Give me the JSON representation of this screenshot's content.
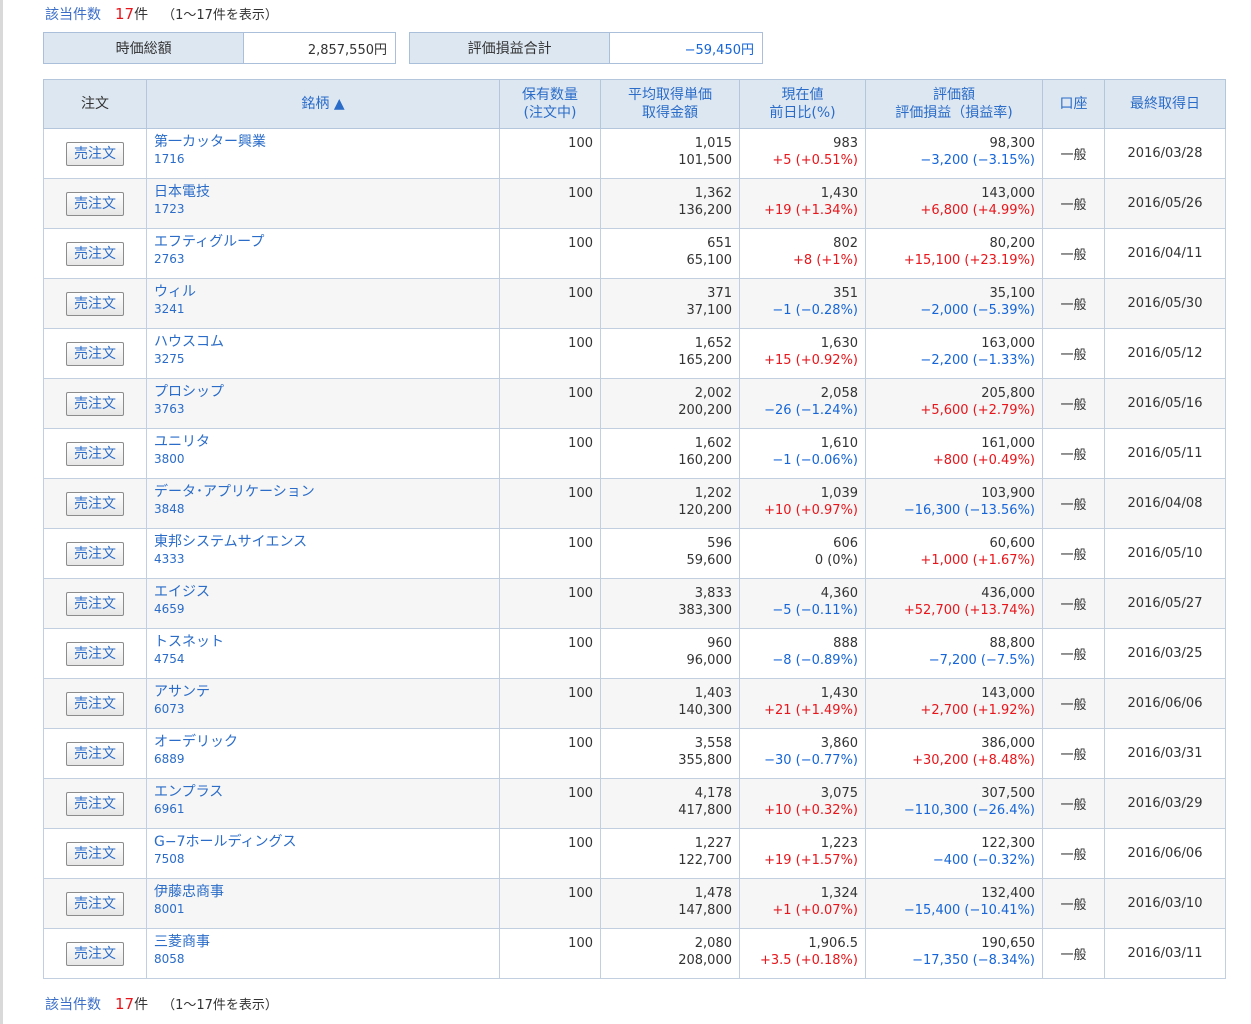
{
  "summary": {
    "count_label": "該当件数",
    "count": "17",
    "count_unit": "件",
    "range_text": "（1〜17件を表示）",
    "market_value_label": "時価総額",
    "market_value": "2,857,550円",
    "pl_total_label": "評価損益合計",
    "pl_total": "−59,450円"
  },
  "table": {
    "headers": {
      "order": "注文",
      "name": "銘柄 ▲",
      "qty_1": "保有数量",
      "qty_2": "(注文中)",
      "avg_1": "平均取得単価",
      "avg_2": "取得金額",
      "price_1": "現在値",
      "price_2": "前日比(%)",
      "eval_1": "評価額",
      "eval_2": "評価損益（損益率)",
      "account": "口座",
      "date": "最終取得日"
    },
    "sell_label": "売注文",
    "rows": [
      {
        "name": "第一カッター興業",
        "code": "1716",
        "qty": "100",
        "avg": "1,015",
        "cost": "101,500",
        "price": "983",
        "chg": "+5 (+0.51%)",
        "chg_sign": "pos",
        "value": "98,300",
        "pl": "−3,200 (−3.15%)",
        "pl_sign": "neg",
        "account": "一般",
        "date": "2016/03/28"
      },
      {
        "name": "日本電技",
        "code": "1723",
        "qty": "100",
        "avg": "1,362",
        "cost": "136,200",
        "price": "1,430",
        "chg": "+19 (+1.34%)",
        "chg_sign": "pos",
        "value": "143,000",
        "pl": "+6,800 (+4.99%)",
        "pl_sign": "pos",
        "account": "一般",
        "date": "2016/05/26"
      },
      {
        "name": "エフティグループ",
        "code": "2763",
        "qty": "100",
        "avg": "651",
        "cost": "65,100",
        "price": "802",
        "chg": "+8 (+1%)",
        "chg_sign": "pos",
        "value": "80,200",
        "pl": "+15,100 (+23.19%)",
        "pl_sign": "pos",
        "account": "一般",
        "date": "2016/04/11"
      },
      {
        "name": "ウィル",
        "code": "3241",
        "qty": "100",
        "avg": "371",
        "cost": "37,100",
        "price": "351",
        "chg": "−1 (−0.28%)",
        "chg_sign": "neg",
        "value": "35,100",
        "pl": "−2,000 (−5.39%)",
        "pl_sign": "neg",
        "account": "一般",
        "date": "2016/05/30"
      },
      {
        "name": "ハウスコム",
        "code": "3275",
        "qty": "100",
        "avg": "1,652",
        "cost": "165,200",
        "price": "1,630",
        "chg": "+15 (+0.92%)",
        "chg_sign": "pos",
        "value": "163,000",
        "pl": "−2,200 (−1.33%)",
        "pl_sign": "neg",
        "account": "一般",
        "date": "2016/05/12"
      },
      {
        "name": "プロシップ",
        "code": "3763",
        "qty": "100",
        "avg": "2,002",
        "cost": "200,200",
        "price": "2,058",
        "chg": "−26 (−1.24%)",
        "chg_sign": "neg",
        "value": "205,800",
        "pl": "+5,600 (+2.79%)",
        "pl_sign": "pos",
        "account": "一般",
        "date": "2016/05/16"
      },
      {
        "name": "ユニリタ",
        "code": "3800",
        "qty": "100",
        "avg": "1,602",
        "cost": "160,200",
        "price": "1,610",
        "chg": "−1 (−0.06%)",
        "chg_sign": "neg",
        "value": "161,000",
        "pl": "+800 (+0.49%)",
        "pl_sign": "pos",
        "account": "一般",
        "date": "2016/05/11"
      },
      {
        "name": "データ･アプリケーション",
        "code": "3848",
        "qty": "100",
        "avg": "1,202",
        "cost": "120,200",
        "price": "1,039",
        "chg": "+10 (+0.97%)",
        "chg_sign": "pos",
        "value": "103,900",
        "pl": "−16,300 (−13.56%)",
        "pl_sign": "neg",
        "account": "一般",
        "date": "2016/04/08"
      },
      {
        "name": "東邦システムサイエンス",
        "code": "4333",
        "qty": "100",
        "avg": "596",
        "cost": "59,600",
        "price": "606",
        "chg": "0 (0%)",
        "chg_sign": "zero",
        "value": "60,600",
        "pl": "+1,000 (+1.67%)",
        "pl_sign": "pos",
        "account": "一般",
        "date": "2016/05/10"
      },
      {
        "name": "エイジス",
        "code": "4659",
        "qty": "100",
        "avg": "3,833",
        "cost": "383,300",
        "price": "4,360",
        "chg": "−5 (−0.11%)",
        "chg_sign": "neg",
        "value": "436,000",
        "pl": "+52,700 (+13.74%)",
        "pl_sign": "pos",
        "account": "一般",
        "date": "2016/05/27"
      },
      {
        "name": "トスネット",
        "code": "4754",
        "qty": "100",
        "avg": "960",
        "cost": "96,000",
        "price": "888",
        "chg": "−8 (−0.89%)",
        "chg_sign": "neg",
        "value": "88,800",
        "pl": "−7,200 (−7.5%)",
        "pl_sign": "neg",
        "account": "一般",
        "date": "2016/03/25"
      },
      {
        "name": "アサンテ",
        "code": "6073",
        "qty": "100",
        "avg": "1,403",
        "cost": "140,300",
        "price": "1,430",
        "chg": "+21 (+1.49%)",
        "chg_sign": "pos",
        "value": "143,000",
        "pl": "+2,700 (+1.92%)",
        "pl_sign": "pos",
        "account": "一般",
        "date": "2016/06/06"
      },
      {
        "name": "オーデリック",
        "code": "6889",
        "qty": "100",
        "avg": "3,558",
        "cost": "355,800",
        "price": "3,860",
        "chg": "−30 (−0.77%)",
        "chg_sign": "neg",
        "value": "386,000",
        "pl": "+30,200 (+8.48%)",
        "pl_sign": "pos",
        "account": "一般",
        "date": "2016/03/31"
      },
      {
        "name": "エンプラス",
        "code": "6961",
        "qty": "100",
        "avg": "4,178",
        "cost": "417,800",
        "price": "3,075",
        "chg": "+10 (+0.32%)",
        "chg_sign": "pos",
        "value": "307,500",
        "pl": "−110,300 (−26.4%)",
        "pl_sign": "neg",
        "account": "一般",
        "date": "2016/03/29"
      },
      {
        "name": "G−7ホールディングス",
        "code": "7508",
        "qty": "100",
        "avg": "1,227",
        "cost": "122,700",
        "price": "1,223",
        "chg": "+19 (+1.57%)",
        "chg_sign": "pos",
        "value": "122,300",
        "pl": "−400 (−0.32%)",
        "pl_sign": "neg",
        "account": "一般",
        "date": "2016/06/06"
      },
      {
        "name": "伊藤忠商事",
        "code": "8001",
        "qty": "100",
        "avg": "1,478",
        "cost": "147,800",
        "price": "1,324",
        "chg": "+1 (+0.07%)",
        "chg_sign": "pos",
        "value": "132,400",
        "pl": "−15,400 (−10.41%)",
        "pl_sign": "neg",
        "account": "一般",
        "date": "2016/03/10"
      },
      {
        "name": "三菱商事",
        "code": "8058",
        "qty": "100",
        "avg": "2,080",
        "cost": "208,000",
        "price": "1,906.5",
        "chg": "+3.5 (+0.18%)",
        "chg_sign": "pos",
        "value": "190,650",
        "pl": "−17,350 (−8.34%)",
        "pl_sign": "neg",
        "account": "一般",
        "date": "2016/03/11"
      }
    ]
  },
  "colors": {
    "link_blue": "#2a6cc8",
    "count_red": "#e8151b",
    "positive_red": "#e8151b",
    "negative_blue": "#1565d8",
    "header_bg": "#dde7f2"
  }
}
